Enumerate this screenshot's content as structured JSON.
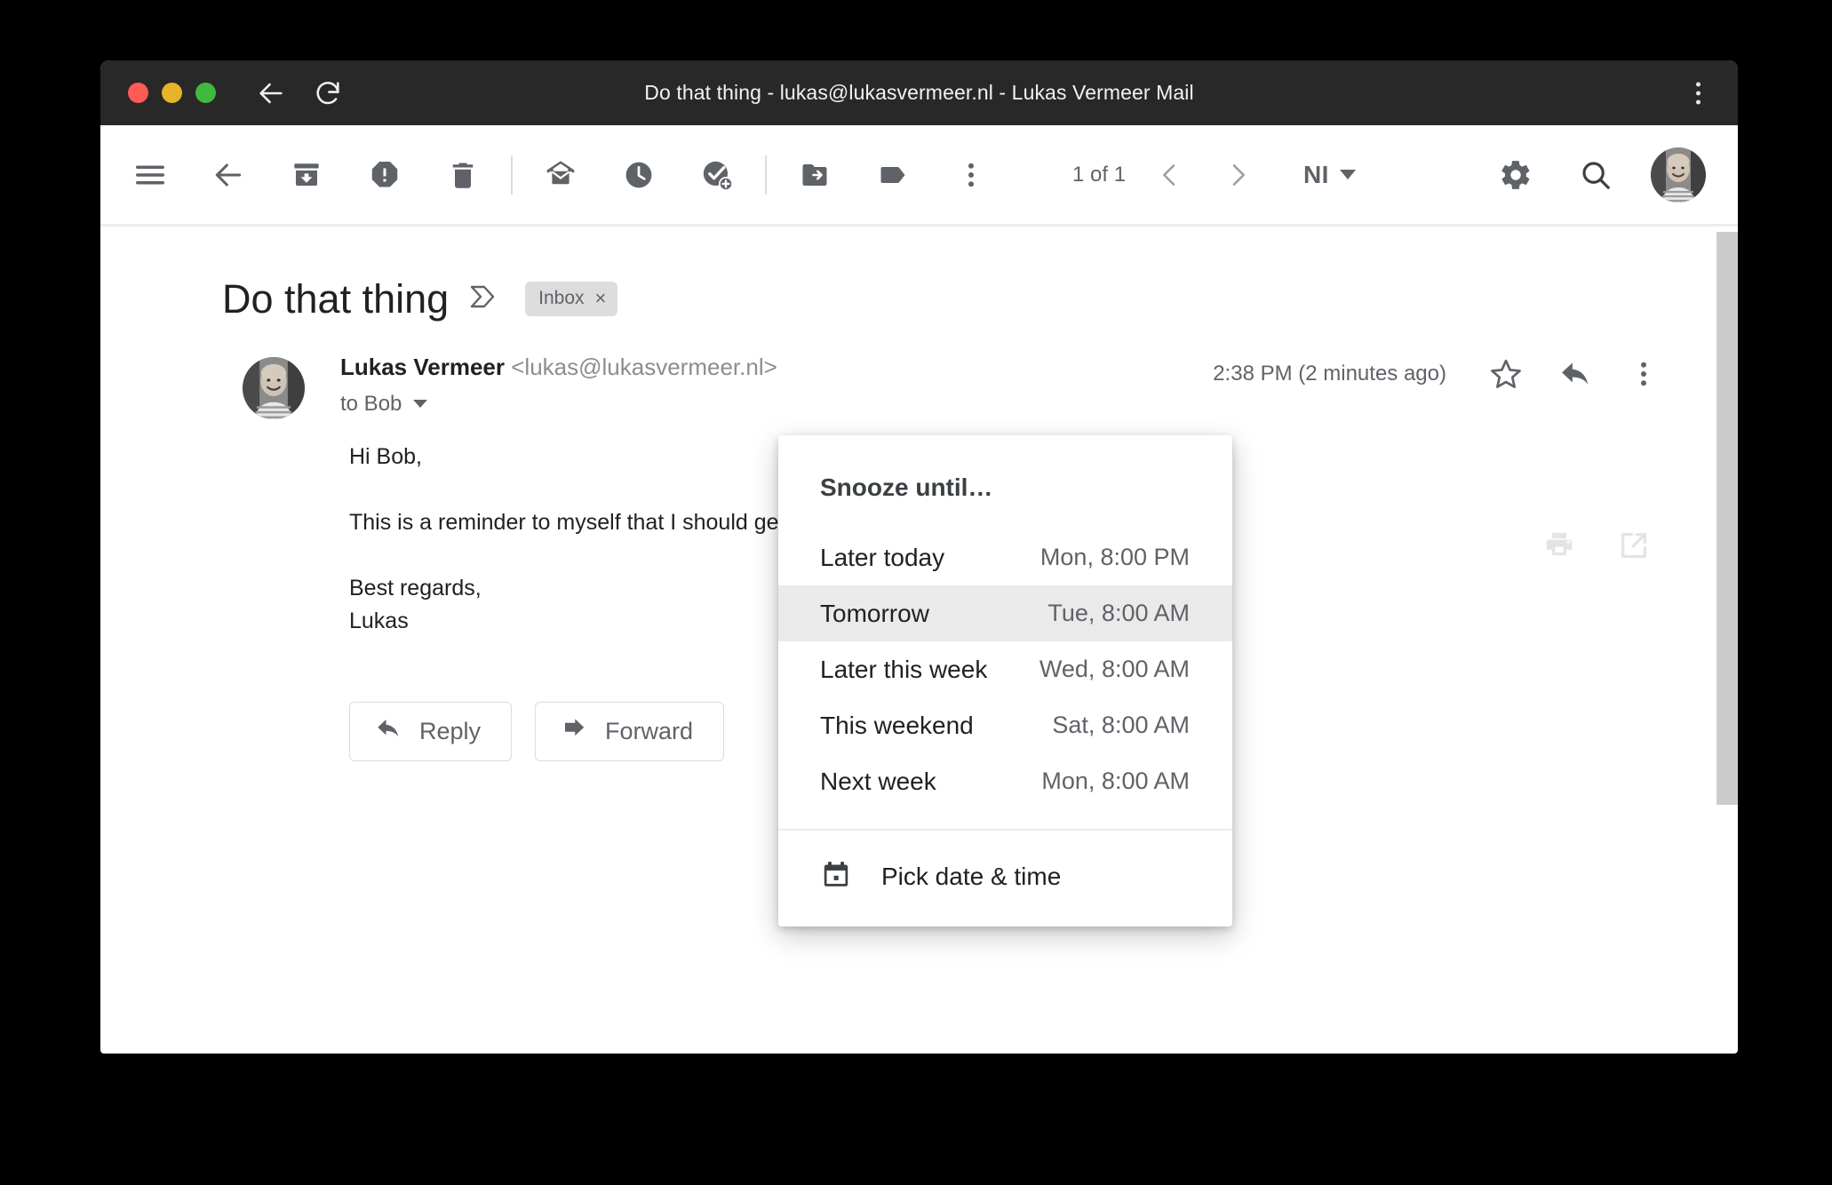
{
  "window": {
    "title": "Do that thing - lukas@lukasvermeer.nl - Lukas Vermeer Mail",
    "traffic_lights": [
      "close",
      "minimize",
      "maximize"
    ],
    "back_icon": "back-arrow-icon",
    "reload_icon": "reload-icon",
    "menu_icon": "browser-menu-icon"
  },
  "toolbar": {
    "hamburger": "hamburger-menu-icon",
    "back": "back-arrow-icon",
    "archive": "archive-icon",
    "spam": "report-spam-icon",
    "delete": "delete-icon",
    "unread": "mark-unread-icon",
    "snooze": "snooze-clock-icon",
    "add_task": "add-to-tasks-icon",
    "move": "move-to-folder-icon",
    "label": "label-tag-icon",
    "more": "more-options-icon",
    "count": "1 of 1",
    "prev": "previous-icon",
    "next": "next-icon",
    "language": "NI",
    "settings": "settings-gear-icon",
    "search": "search-icon",
    "account": "account-avatar"
  },
  "mail": {
    "subject": "Do that thing",
    "important_marker": "important-marker-icon",
    "label": "Inbox",
    "label_remove": "×",
    "print_icon": "print-icon",
    "popout_icon": "open-in-new-window-icon",
    "sender_name": "Lukas Vermeer",
    "sender_email": "<lukas@lukasvermeer.nl>",
    "recipient": "to Bob",
    "time": "2:38 PM (2 minutes ago)",
    "star_icon": "star-icon",
    "reply_icon": "reply-icon",
    "more_icon": "more-options-icon",
    "body": {
      "greeting": "Hi Bob,",
      "paragraph": "This is a reminder to myself that I should get this done in time.",
      "signoff": "Best regards,",
      "signature": "Lukas"
    },
    "reply_button": "Reply",
    "forward_button": "Forward"
  },
  "snooze_menu": {
    "header": "Snooze until…",
    "items": [
      {
        "label": "Later today",
        "value": "Mon, 8:00 PM",
        "active": false
      },
      {
        "label": "Tomorrow",
        "value": "Tue, 8:00 AM",
        "active": true
      },
      {
        "label": "Later this week",
        "value": "Wed, 8:00 AM",
        "active": false
      },
      {
        "label": "This weekend",
        "value": "Sat, 8:00 AM",
        "active": false
      },
      {
        "label": "Next week",
        "value": "Mon, 8:00 AM",
        "active": false
      }
    ],
    "pick_label": "Pick date & time",
    "pick_icon": "calendar-icon",
    "highlight_color": "#eaeaea"
  },
  "colors": {
    "titlebar": "#282828",
    "icon_gray": "#5f6368",
    "chip_gray": "#ddddde",
    "page_background": "#000000"
  }
}
